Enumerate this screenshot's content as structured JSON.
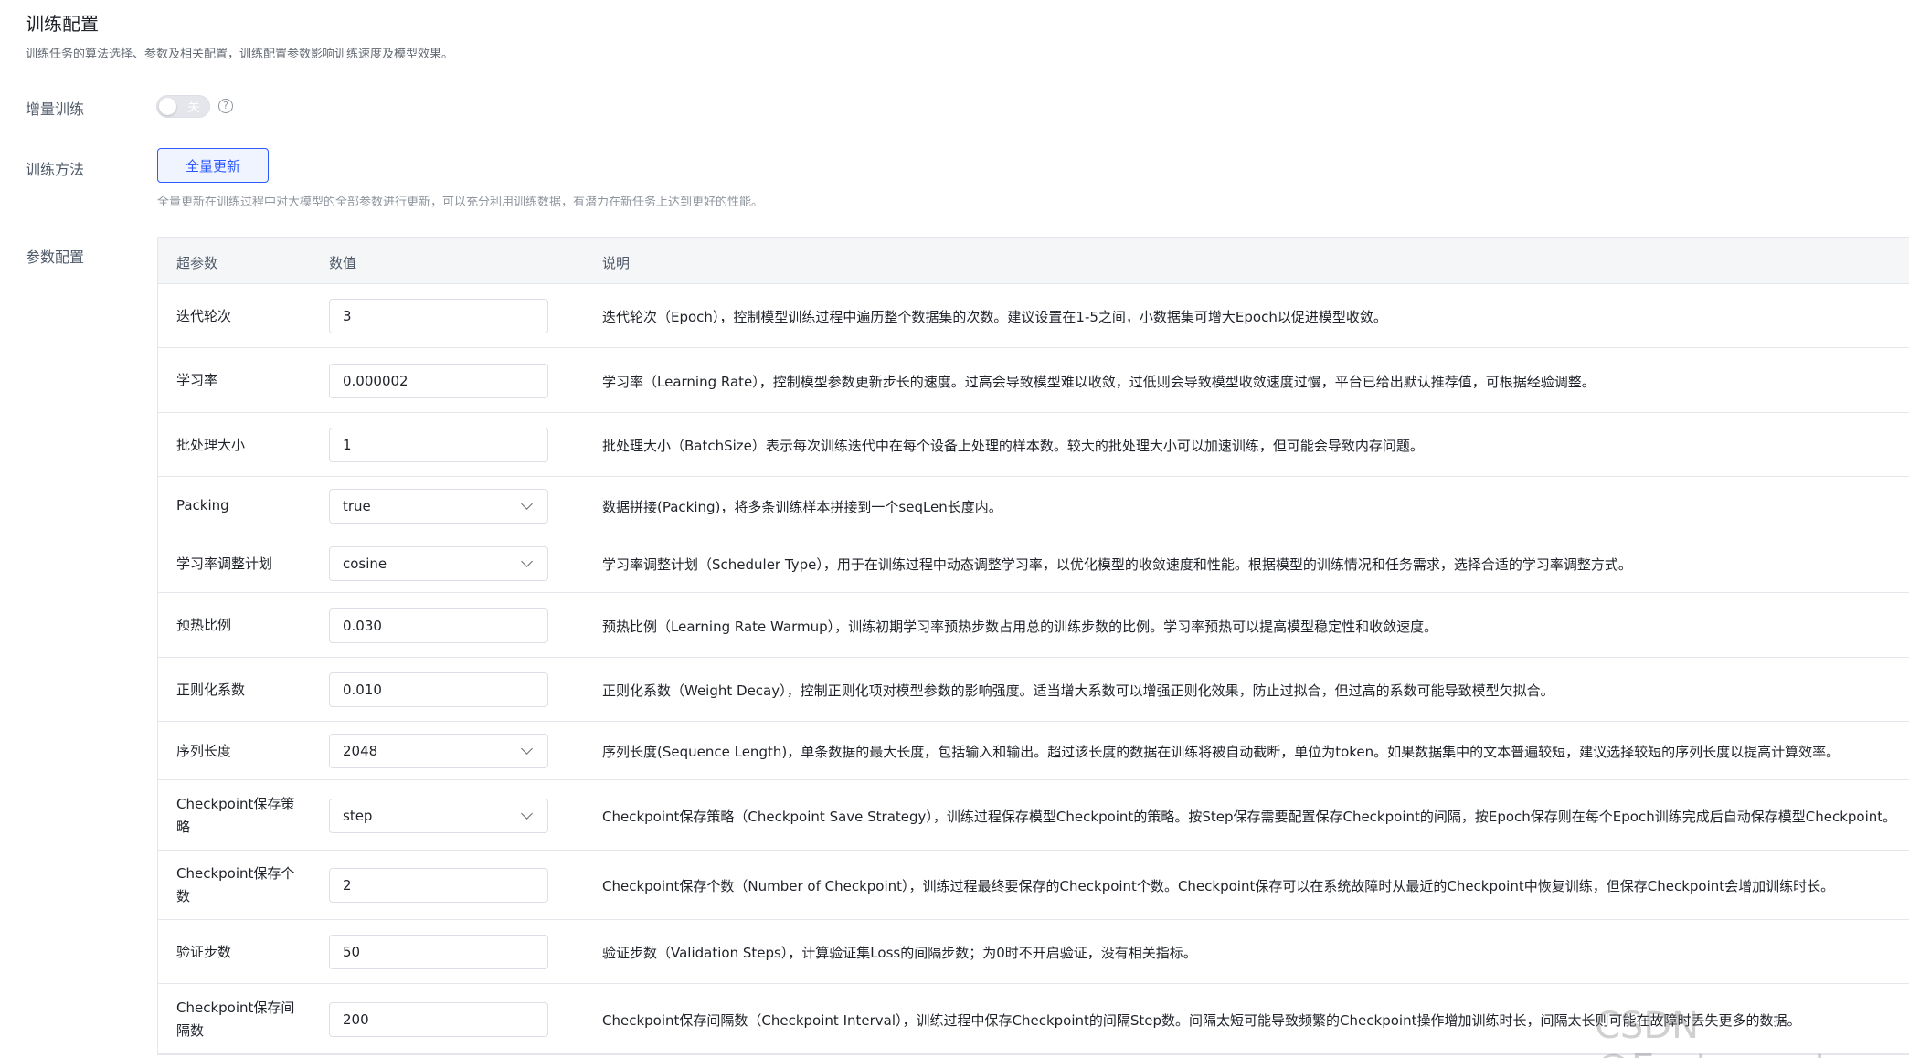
{
  "header": {
    "title": "训练配置",
    "description": "训练任务的算法选择、参数及相关配置，训练配置参数影响训练速度及模型效果。"
  },
  "incremental": {
    "label": "增量训练",
    "toggle_text": "关",
    "toggle_on": false
  },
  "method": {
    "label": "训练方法",
    "selected": "全量更新",
    "description": "全量更新在训练过程中对大模型的全部参数进行更新，可以充分利用训练数据，有潜力在新任务上达到更好的性能。"
  },
  "params": {
    "label": "参数配置",
    "columns": [
      "超参数",
      "数值",
      "说明"
    ],
    "rows": [
      {
        "name": "迭代轮次",
        "value": "3",
        "type": "input",
        "desc": "迭代轮次（Epoch），控制模型训练过程中遍历整个数据集的次数。建议设置在1-5之间，小数据集可增大Epoch以促进模型收敛。"
      },
      {
        "name": "学习率",
        "value": "0.000002",
        "type": "input",
        "desc": "学习率（Learning Rate），控制模型参数更新步长的速度。过高会导致模型难以收敛，过低则会导致模型收敛速度过慢，平台已给出默认推荐值，可根据经验调整。"
      },
      {
        "name": "批处理大小",
        "value": "1",
        "type": "input",
        "desc": "批处理大小（BatchSize）表示每次训练迭代中在每个设备上处理的样本数。较大的批处理大小可以加速训练，但可能会导致内存问题。"
      },
      {
        "name": "Packing",
        "value": "true",
        "type": "select",
        "desc": "数据拼接(Packing)，将多条训练样本拼接到一个seqLen长度内。"
      },
      {
        "name": "学习率调整计划",
        "value": "cosine",
        "type": "select",
        "desc": "学习率调整计划（Scheduler Type），用于在训练过程中动态调整学习率，以优化模型的收敛速度和性能。根据模型的训练情况和任务需求，选择合适的学习率调整方式。"
      },
      {
        "name": "预热比例",
        "value": "0.030",
        "type": "input",
        "desc": "预热比例（Learning Rate Warmup），训练初期学习率预热步数占用总的训练步数的比例。学习率预热可以提高模型稳定性和收敛速度。"
      },
      {
        "name": "正则化系数",
        "value": "0.010",
        "type": "input",
        "desc": "正则化系数（Weight Decay），控制正则化项对模型参数的影响强度。适当增大系数可以增强正则化效果，防止过拟合，但过高的系数可能导致模型欠拟合。"
      },
      {
        "name": "序列长度",
        "value": "2048",
        "type": "select",
        "desc": "序列长度(Sequence Length)，单条数据的最大长度，包括输入和输出。超过该长度的数据在训练将被自动截断，单位为token。如果数据集中的文本普遍较短，建议选择较短的序列长度以提高计算效率。"
      },
      {
        "name": "Checkpoint保存策略",
        "value": "step",
        "type": "select",
        "desc": "Checkpoint保存策略（Checkpoint Save Strategy），训练过程保存模型Checkpoint的策略。按Step保存需要配置保存Checkpoint的间隔，按Epoch保存则在每个Epoch训练完成后自动保存模型Checkpoint。"
      },
      {
        "name": "Checkpoint保存个数",
        "value": "2",
        "type": "input",
        "desc": "Checkpoint保存个数（Number of Checkpoint），训练过程最终要保存的Checkpoint个数。Checkpoint保存可以在系统故障时从最近的Checkpoint中恢复训练，但保存Checkpoint会增加训练时长。"
      },
      {
        "name": "验证步数",
        "value": "50",
        "type": "input",
        "desc": "验证步数（Validation Steps），计算验证集Loss的间隔步数；为0时不开启验证，没有相关指标。"
      },
      {
        "name": "Checkpoint保存间隔数",
        "value": "200",
        "type": "input",
        "desc": "Checkpoint保存间隔数（Checkpoint Interval），训练过程中保存Checkpoint的间隔Step数。间隔太短可能导致频繁的Checkpoint操作增加训练时长，间隔太长则可能在故障时丢失更多的数据。"
      }
    ]
  },
  "watermark": "CSDN @Eastmount"
}
